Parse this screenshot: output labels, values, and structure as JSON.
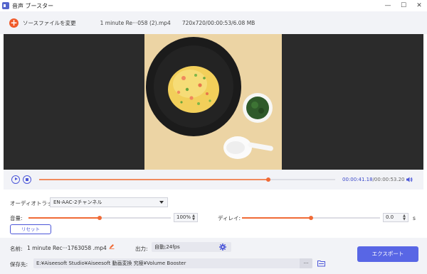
{
  "window": {
    "title": "音声 ブースター",
    "minimize_glyph": "—",
    "maximize_glyph": "☐",
    "close_glyph": "✕"
  },
  "toolbar": {
    "add_glyph": "+",
    "add_source_label": "ソースファイルを変更",
    "file_name": "1 minute Re···058 (2).mp4",
    "file_meta": "720x720/00:00:53/6.08 MB"
  },
  "playback": {
    "current_time": "00:00:41.18",
    "total_time": "/00:00:53.20",
    "progress_fraction": 0.775
  },
  "audio": {
    "track_label": "オーディオトラック:",
    "track_value": "EN-AAC-2チャンネル",
    "volume_label": "音量:",
    "volume_value": "100%",
    "volume_fraction": 0.5,
    "delay_label": "ディレイ:",
    "delay_value": "0.0",
    "delay_unit": "s",
    "delay_fraction": 0.5,
    "reset_label": "リセット"
  },
  "output": {
    "name_label": "名前:",
    "name_value": "1 minute Rec···1763058 .mp4",
    "format_label": "出力:",
    "format_value": "自動;24fps",
    "save_label": "保存先:",
    "save_path": "E:¥Aiseesoft Studio¥Aiseesoft 動画変換 究極¥Volume Booster",
    "browse_glyph": "···",
    "export_label": "エクスポート"
  },
  "colors": {
    "accent": "#5866e5",
    "progress": "#f06a35"
  },
  "icons": [
    "app-icon",
    "add-icon",
    "play-icon",
    "stop-icon",
    "speaker-icon",
    "edit-icon",
    "gear-icon",
    "folder-icon"
  ]
}
